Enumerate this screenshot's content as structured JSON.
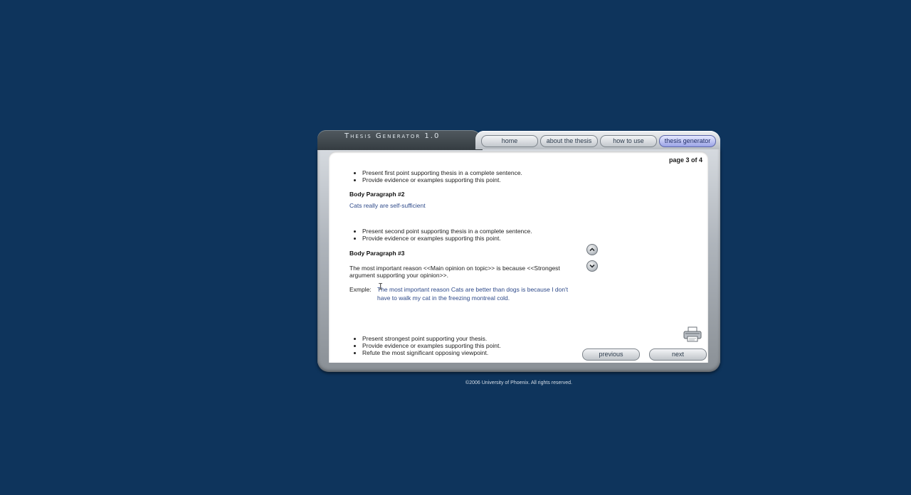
{
  "app": {
    "title": "Thesis Generator 1.0"
  },
  "nav": {
    "items": [
      {
        "label": "home"
      },
      {
        "label": "about the thesis"
      },
      {
        "label": "how to use"
      },
      {
        "label": "thesis generator"
      }
    ],
    "active": "thesis generator"
  },
  "page": {
    "indicator": "page 3 of 4"
  },
  "content": {
    "bullets_1": [
      "Present first point supporting thesis in a complete sentence.",
      "Provide evidence or examples supporting this point."
    ],
    "body2": {
      "heading": "Body Paragraph #2",
      "answer": "Cats really are self-sufficient",
      "bullets": [
        "Present second point supporting thesis in a complete sentence.",
        "Provide evidence or examples supporting this point."
      ]
    },
    "body3": {
      "heading": "Body Paragraph #3",
      "instruction": "The most important reason <<Main opinion on topic>> is because <<Strongest argument supporting your opinion>>.",
      "example_label": "Exmple:",
      "example_text": "The most important reason Cats are better than dogs is because I don't have to walk my cat in the freezing montreal cold.",
      "bullets": [
        "Present strongest point supporting your thesis.",
        "Provide evidence or examples supporting this point.",
        "Refute the most significant opposing viewpoint."
      ]
    }
  },
  "controls": {
    "previous_label": "previous",
    "next_label": "next"
  },
  "footer": {
    "copyright": "©2006 University of Phoenix. All rights reserved."
  },
  "colors": {
    "background": "#0e345c",
    "answer_text": "#2e4a8a",
    "active_tab": "#9aa3e6"
  }
}
